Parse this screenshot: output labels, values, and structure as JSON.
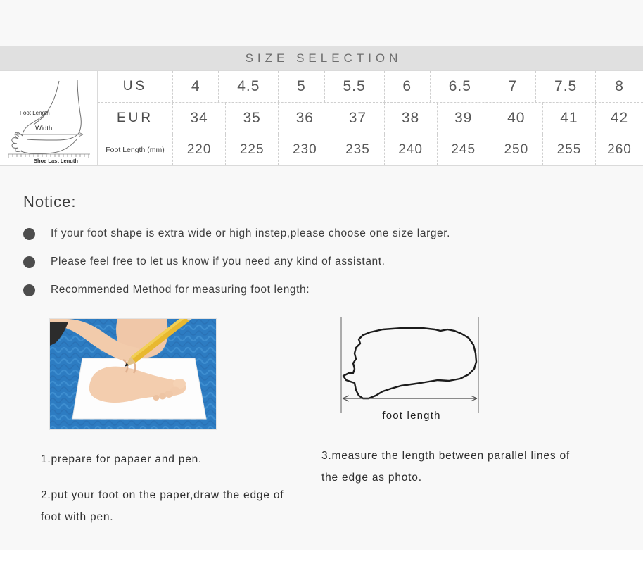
{
  "header": {
    "title": "SIZE SELECTION"
  },
  "foot_diagram": {
    "foot_length_label": "Foot Length",
    "width_label": "Width",
    "shoe_last_label": "Shoe Last Length"
  },
  "size_table": {
    "row_labels": [
      "US",
      "EUR",
      "Foot Length  (mm)"
    ],
    "rows": [
      {
        "label": "US",
        "values": [
          "4",
          "4.5",
          "5",
          "5.5",
          "6",
          "6.5",
          "7",
          "7.5",
          "8"
        ]
      },
      {
        "label": "EUR",
        "values": [
          "34",
          "35",
          "36",
          "37",
          "38",
          "39",
          "40",
          "41",
          "42"
        ]
      },
      {
        "label": "Foot Length  (mm)",
        "values": [
          "220",
          "225",
          "230",
          "235",
          "240",
          "245",
          "250",
          "255",
          "260"
        ]
      }
    ]
  },
  "notice": {
    "heading": "Notice:",
    "items": [
      "If your foot shape is extra wide or high instep,please choose one size larger.",
      "Please feel free to let us know if you need any kind of assistant.",
      "Recommended Method for measuring foot length:"
    ]
  },
  "steps": {
    "step1": "1.prepare for papaer and pen.",
    "step2": "2.put your foot on the paper,draw the edge of foot with pen.",
    "step3": "3.measure the length between parallel lines of the edge as photo."
  },
  "outline_figure": {
    "caption": "foot length"
  },
  "colors": {
    "page_background": "#f8f8f8",
    "header_band": "#e0e0e0",
    "header_text": "#6e6e6e",
    "table_background": "#ffffff",
    "table_border": "#dadada",
    "cell_divider": "#cfcfcf",
    "bullet": "#4d4d4d",
    "body_text": "#3d3d3d"
  }
}
